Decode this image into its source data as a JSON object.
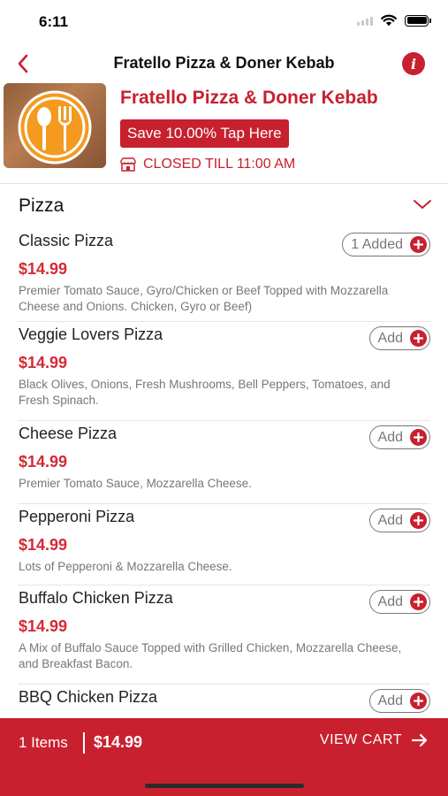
{
  "status_bar": {
    "time": "6:11"
  },
  "nav": {
    "title": "Fratello Pizza & Doner Kebab"
  },
  "restaurant": {
    "name": "Fratello Pizza & Doner Kebab",
    "promo_label": "Save 10.00% Tap Here",
    "status_text": "CLOSED TILL 11:00 AM"
  },
  "category": {
    "title": "Pizza"
  },
  "items": [
    {
      "name": "Classic Pizza",
      "price": "$14.99",
      "desc": "Premier Tomato Sauce, Gyro/Chicken or Beef Topped with Mozzarella Cheese and Onions. Chicken, Gyro or Beef)",
      "button": "1 Added"
    },
    {
      "name": "Veggie Lovers Pizza",
      "price": "$14.99",
      "desc": "Black Olives, Onions, Fresh Mushrooms, Bell Peppers, Tomatoes, and Fresh Spinach.",
      "button": "Add"
    },
    {
      "name": "Cheese Pizza",
      "price": "$14.99",
      "desc": "Premier Tomato Sauce, Mozzarella Cheese.",
      "button": "Add"
    },
    {
      "name": "Pepperoni Pizza",
      "price": "$14.99",
      "desc": "Lots of Pepperoni & Mozzarella Cheese.",
      "button": "Add"
    },
    {
      "name": "Buffalo Chicken Pizza",
      "price": "$14.99",
      "desc": "A Mix of Buffalo Sauce Topped with Grilled Chicken, Mozzarella Cheese, and Breakfast Bacon.",
      "button": "Add"
    },
    {
      "name": "BBQ Chicken Pizza",
      "price": "",
      "desc": "",
      "button": "Add"
    }
  ],
  "cart": {
    "count_label": "1 Items",
    "total": "$14.99",
    "view_label": "VIEW CART"
  },
  "colors": {
    "accent": "#c8202f",
    "price": "#d42a35"
  }
}
